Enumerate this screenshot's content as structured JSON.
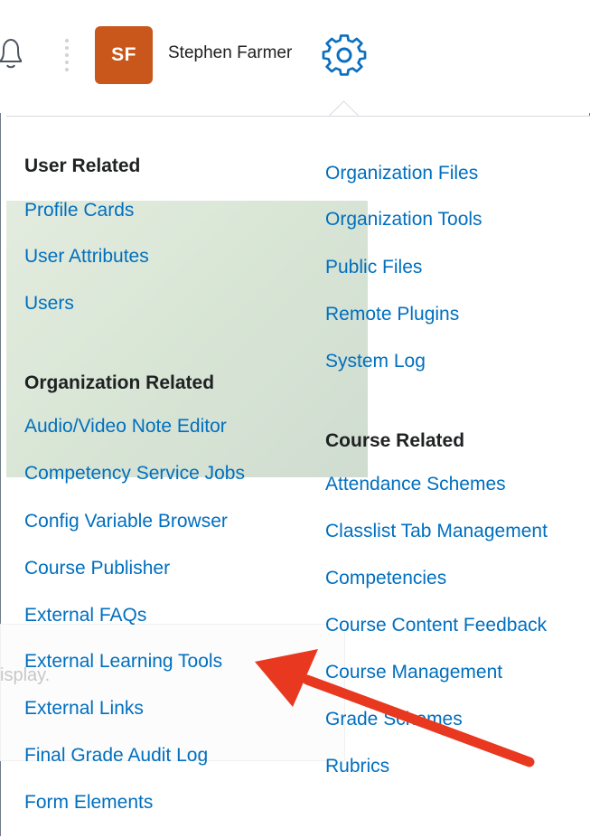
{
  "header": {
    "avatar_initials": "SF",
    "user_name": "Stephen Farmer",
    "icons": [
      "bell-icon",
      "more-vertical-icon",
      "gear-icon"
    ]
  },
  "ghost_text": "isplay.",
  "left_column": {
    "user_related_heading": "User Related",
    "user_related": [
      "Profile Cards",
      "User Attributes",
      "Users"
    ],
    "organization_related_heading": "Organization Related",
    "organization_related": [
      "Audio/Video Note Editor",
      "Competency Service Jobs",
      "Config Variable Browser",
      "Course Publisher",
      "External FAQs",
      "External Learning Tools",
      "External Links",
      "Final Grade Audit Log",
      "Form Elements"
    ]
  },
  "right_column": {
    "organization_items": [
      "Organization Files",
      "Organization Tools",
      "Public Files",
      "Remote Plugins",
      "System Log"
    ],
    "course_related_heading": "Course Related",
    "course_related": [
      "Attendance Schemes",
      "Classlist Tab Management",
      "Competencies",
      "Course Content Feedback",
      "Course Management",
      "Grade Schemes",
      "Rubrics"
    ]
  },
  "colors": {
    "link": "#006fbf",
    "avatar_bg": "#c9571b",
    "arrow": "#e8381f"
  }
}
